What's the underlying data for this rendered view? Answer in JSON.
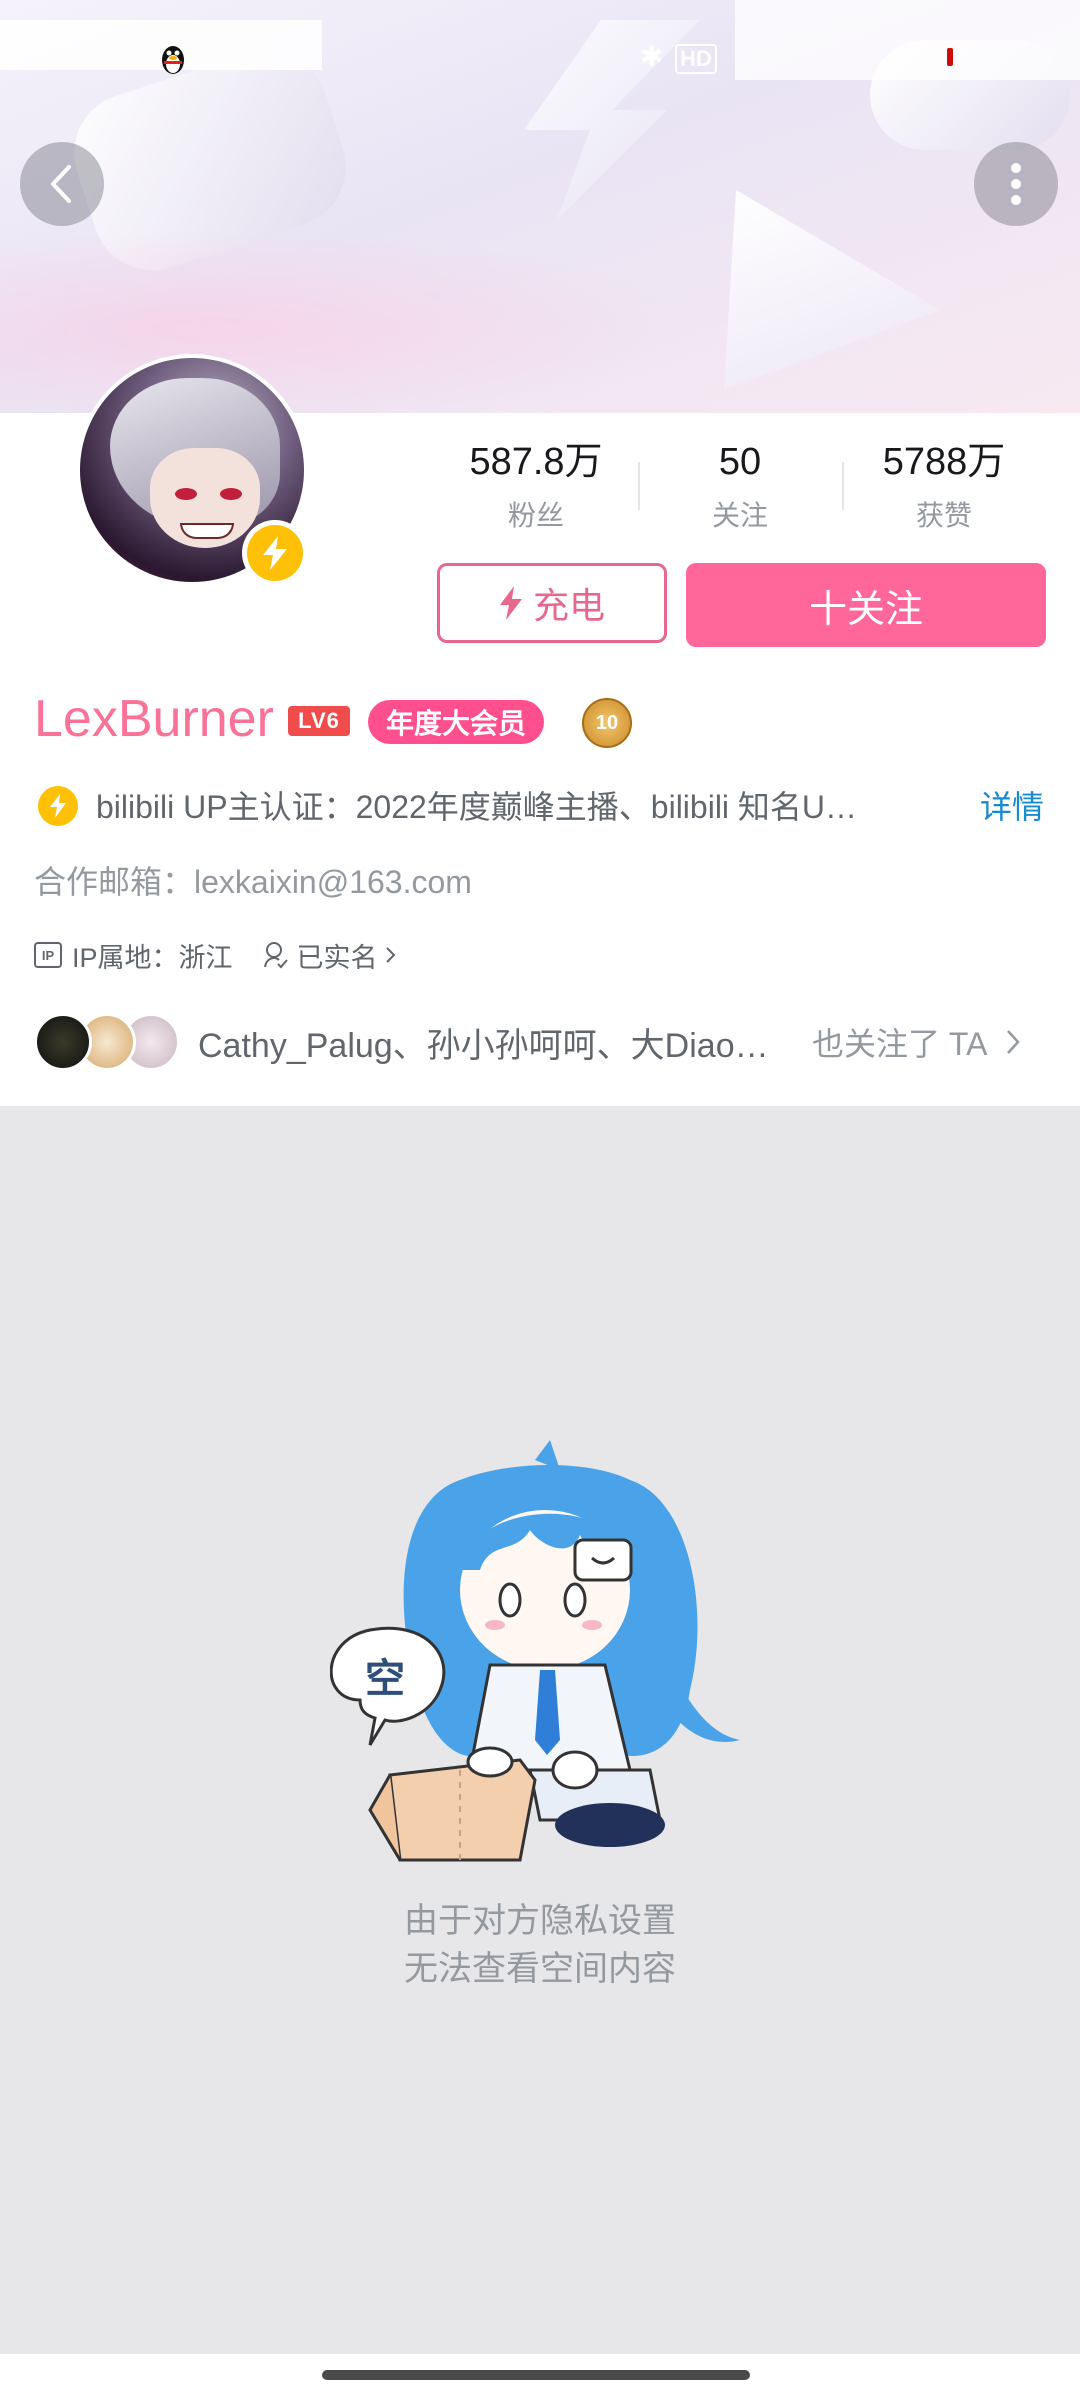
{
  "status_bar": {
    "hd_label": "HD"
  },
  "profile": {
    "name": "LexBurner",
    "level": "LV6",
    "vip_badge": "年度大会员",
    "medal_text": "10",
    "certification": "bilibili UP主认证：2022年度巅峰主播、bilibili 知名U…",
    "detail_link": "详情",
    "email": "合作邮箱：lexkaixin@163.com",
    "ip_icon_text": "IP",
    "ip_location": "IP属地：浙江",
    "real_name": "已实名"
  },
  "stats": [
    {
      "value": "587.8万",
      "label": "粉丝"
    },
    {
      "value": "50",
      "label": "关注"
    },
    {
      "value": "5788万",
      "label": "获赞"
    }
  ],
  "actions": {
    "charge_label": "充电",
    "follow_label": "十关注"
  },
  "mutual_follow": {
    "names": "Cathy_Palug、孙小孙呵呵、大Diao…",
    "suffix": "也关注了 TA"
  },
  "empty_state": {
    "bubble": "空",
    "line1": "由于对方隐私设置",
    "line2": "无法查看空间内容"
  },
  "colors": {
    "brand_pink": "#fb7299",
    "follow_bg": "#ff6699",
    "link_blue": "#178bcf",
    "vip_pink": "#ff4f8e",
    "lv6_red": "#f04c4c"
  }
}
